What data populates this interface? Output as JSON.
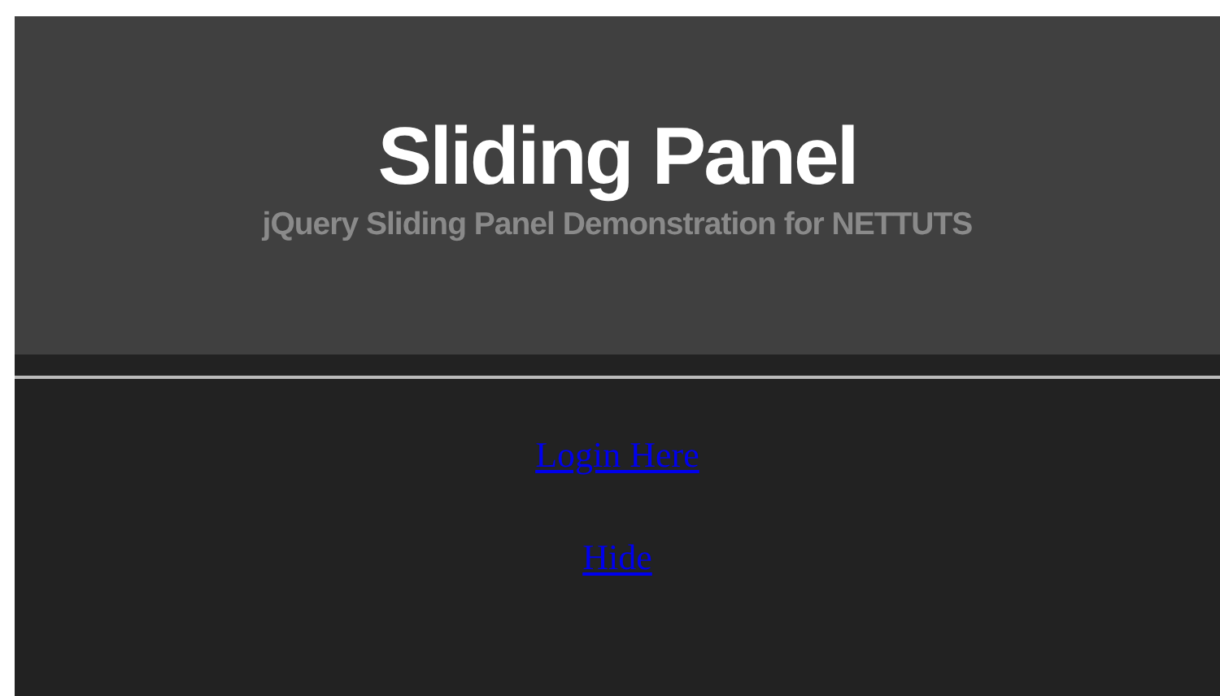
{
  "header": {
    "title": "Sliding Panel",
    "subtitle": "jQuery Sliding Panel Demonstration for NETTUTS"
  },
  "links": [
    {
      "label": "Login Here"
    },
    {
      "label": "Hide"
    }
  ]
}
